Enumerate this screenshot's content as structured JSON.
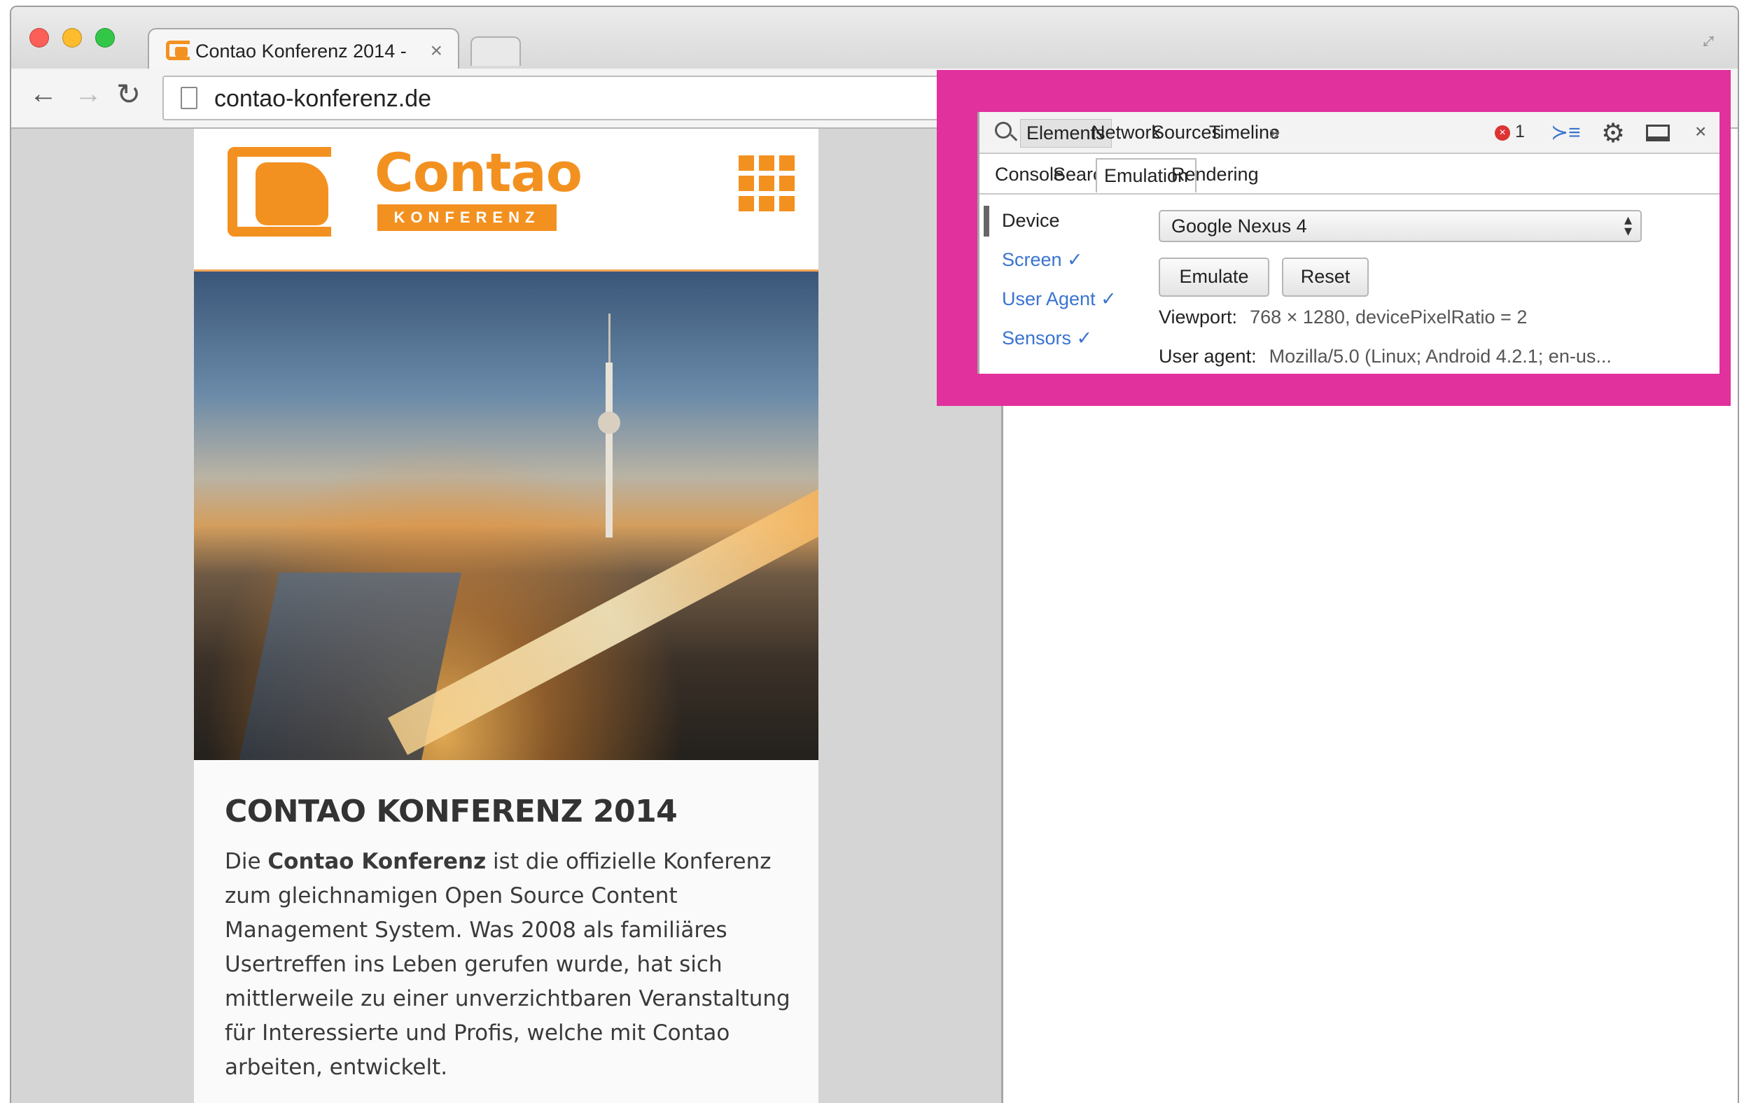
{
  "browser": {
    "tab_title": "Contao Konferenz 2014 -",
    "tab_close": "×",
    "url": "contao-konferenz.de",
    "icons": {
      "back": "back-arrow-icon",
      "forward": "forward-arrow-icon",
      "reload": "reload-icon",
      "page": "page-icon",
      "fullscreen": "fullscreen-icon"
    }
  },
  "site": {
    "logo_word": "Contao",
    "logo_sub": "KONFERENZ",
    "heading": "CONTAO KONFERENZ 2014",
    "intro_lead": "Die ",
    "intro_bold": "Contao Konferenz",
    "intro_rest": " ist die offizielle Konferenz zum gleichnamigen Open Source Content Management System. Was 2008 als familiäres Usertreffen ins Leben gerufen wurde, hat sich mittlerweile zu einer unverzichtbaren Veranstaltung für Interessierte und Profis, welche mit Contao arbeiten, entwickelt.",
    "accent_color": "#f39120"
  },
  "devtools": {
    "tabs": [
      "Elements",
      "Network",
      "Sources",
      "Timeline",
      "»"
    ],
    "error_count": "1",
    "error_glyph": "×",
    "subtabs": [
      "Console",
      "Search",
      "Emulation",
      "Rendering"
    ],
    "side_items": [
      "Device",
      "Screen ✓",
      "User Agent ✓",
      "Sensors ✓"
    ],
    "device_value": "Google Nexus 4",
    "emulate_label": "Emulate",
    "reset_label": "Reset",
    "viewport_key": "Viewport:",
    "viewport_value": "768 × 1280, devicePixelRatio = 2",
    "ua_key": "User agent:",
    "ua_value": "Mozilla/5.0 (Linux; Android 4.2.1; en-us...",
    "highlight_color": "#e1319c"
  }
}
